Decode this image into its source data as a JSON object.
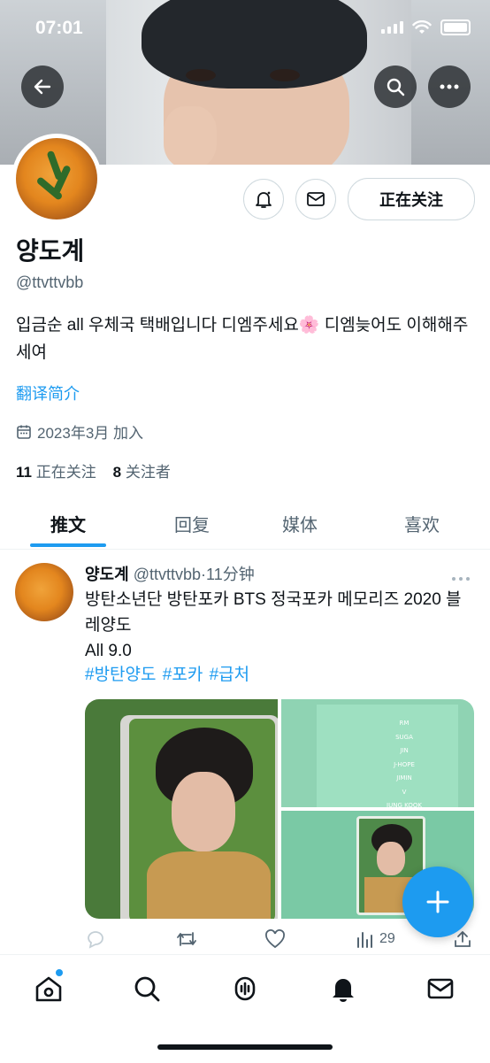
{
  "status": {
    "time": "07:01"
  },
  "profile": {
    "name": "양도계",
    "handle": "@ttvttvbb",
    "bio": "입금순 all 우체국 택배입니다 디엠주세요🌸 디엠늦어도 이해해주세여",
    "translate_label": "翻译简介",
    "joined": "2023年3月 加入",
    "following_count": "11",
    "following_label": "正在关注",
    "followers_count": "8",
    "followers_label": "关注者",
    "follow_button": "正在关注"
  },
  "tabs": [
    {
      "label": "推文",
      "active": true
    },
    {
      "label": "回复",
      "active": false
    },
    {
      "label": "媒体",
      "active": false
    },
    {
      "label": "喜欢",
      "active": false
    }
  ],
  "tweet": {
    "name": "양도계",
    "handle": "@ttvttvbb",
    "separator": "·",
    "time": "11分钟",
    "text": "방탄소년단 방탄포카 BTS 정국포카 메모리즈 2020 블레양도",
    "line2": "All 9.0",
    "hashtags": "#방탄양도 #포카 #급처",
    "views": "29",
    "card_members": [
      "RM",
      "SUGA",
      "JIN",
      "J-HOPE",
      "JIMIN",
      "V",
      "JUNG KOOK"
    ]
  },
  "colors": {
    "accent": "#1d9bf0",
    "text": "#0f1419",
    "muted": "#536471"
  },
  "icons": {
    "back": "arrow-left-icon",
    "search": "search-icon",
    "more": "more-icon",
    "notify": "bell-icon",
    "message": "mail-icon"
  }
}
